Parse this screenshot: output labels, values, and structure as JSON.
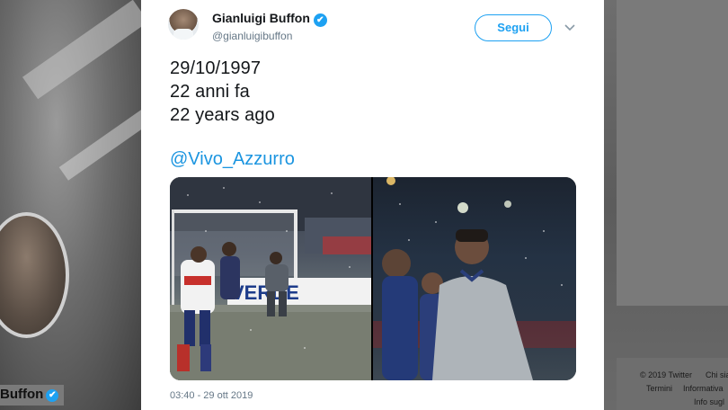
{
  "background": {
    "profile_name": "Buffon",
    "footer": {
      "copyright": "© 2019 Twitter",
      "about": "Chi sia",
      "terms": "Termini",
      "privacy": "Informativa",
      "ads_info": "Info sugl"
    }
  },
  "tweet": {
    "author": {
      "name": "Gianluigi Buffon",
      "handle": "@gianluigibuffon",
      "verified_icon": "✔"
    },
    "follow_label": "Segui",
    "text_lines": [
      "29/10/1997",
      "22 anni fa",
      "22 years ago"
    ],
    "mention": "@Vivo_Azzurro",
    "timestamp": "03:40 - 29 ott 2019",
    "media": {
      "left_banner_text": "VERDE",
      "photos": [
        "football-match-in-snow",
        "players-in-snow-portrait"
      ]
    }
  },
  "colors": {
    "accent": "#1da1f2",
    "link": "#1b95e0",
    "text": "#14171a",
    "secondary_text": "#657786"
  }
}
